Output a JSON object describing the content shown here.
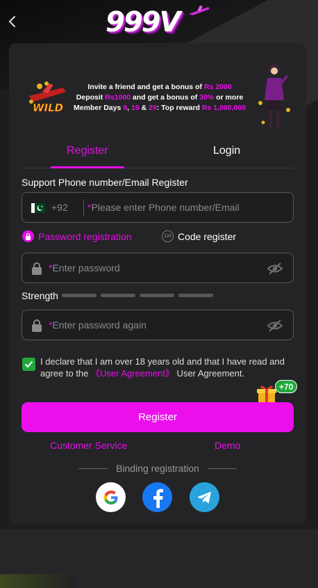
{
  "header": {
    "logo_text": "999V"
  },
  "promo": {
    "line1_prefix": "Invite a friend and get a bonus of ",
    "line1_amount": "Rs 2000",
    "line2_prefix": "Deposit ",
    "line2_deposit": "Rs1000",
    "line2_mid": " and get a bonus of ",
    "line2_percent": "30%",
    "line2_suffix": " or more",
    "line3_prefix": "Member Days ",
    "line3_day1": "9",
    "line3_sep1": ", ",
    "line3_day2": "19",
    "line3_sep2": " & ",
    "line3_day3": "29",
    "line3_mid": ": Top reward ",
    "line3_reward": "Rs 1,000,000",
    "wild_label": "WILD"
  },
  "tabs": {
    "register": "Register",
    "login": "Login",
    "active": "register"
  },
  "form": {
    "section_label": "Support Phone number/Email Register",
    "country_code": "+92",
    "required_mark": "*",
    "phone_placeholder": "Please enter Phone number/Email",
    "mode_password": "Password registration",
    "mode_code": "Code register",
    "mode_code_icon_text": "123",
    "password_placeholder": "Enter password",
    "strength_label": "Strength",
    "strength_level": 0,
    "strength_segments": 4,
    "password_again_placeholder": "Enter password again",
    "agree_checked": true,
    "agree_text_1": "I declare that I am over 18 years old and that I have read and agree to the ",
    "agree_link": "《User Agreement》",
    "agree_text_2": " User Agreement.",
    "gift_badge": "+70",
    "register_button": "Register"
  },
  "links": {
    "customer_service": "Customer Service",
    "demo": "Demo"
  },
  "binding": {
    "label": "Binding registration",
    "providers": [
      "google-icon",
      "facebook-icon",
      "telegram-icon"
    ]
  },
  "colors": {
    "accent": "#ec0fec",
    "checkbox": "#1fa83b",
    "facebook": "#1877f2",
    "telegram": "#2aa3dc"
  }
}
